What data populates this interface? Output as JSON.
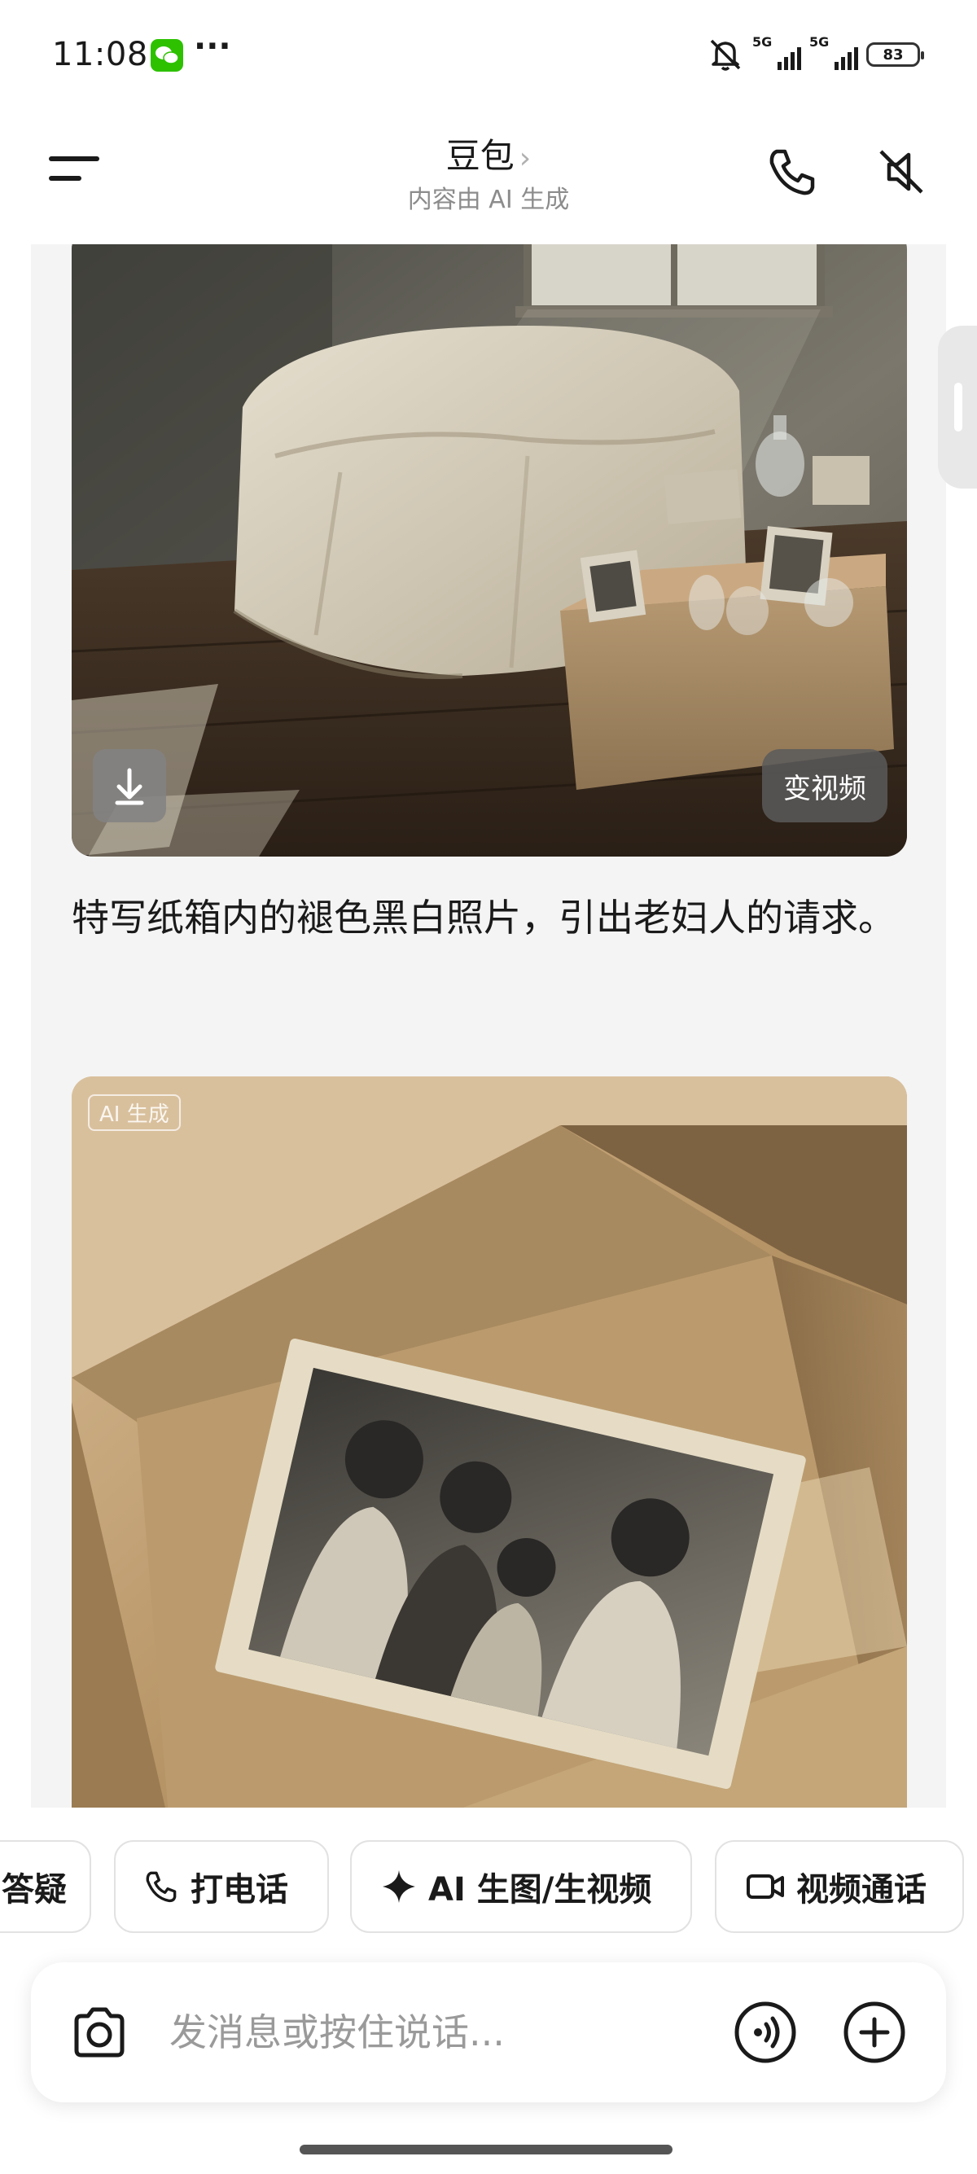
{
  "status_bar": {
    "time": "11:08",
    "more": "···",
    "signal1_label": "5G",
    "signal2_label": "5G",
    "battery": "83",
    "icons": [
      "wechat-icon",
      "bell-off-icon",
      "signal-icon",
      "battery-icon"
    ]
  },
  "header": {
    "title": "豆包",
    "subtitle": "内容由 AI 生成",
    "icons": [
      "menu-icon",
      "chevron-right-icon",
      "phone-icon",
      "speaker-mute-icon"
    ]
  },
  "chat": {
    "image1": {
      "download_icon": "download-icon",
      "video_button": "变视频"
    },
    "caption": "特写纸箱内的褪色黑白照片，引出老妇人的请求。",
    "image2": {
      "badge": "AI 生成"
    }
  },
  "chips": [
    {
      "label": "答疑",
      "icon": ""
    },
    {
      "label": "打电话",
      "icon": "phone-icon"
    },
    {
      "label": "AI 生图/生视频",
      "icon": "sparkle-icon"
    },
    {
      "label": "视频通话",
      "icon": "video-camera-icon"
    }
  ],
  "input_bar": {
    "placeholder": "发消息或按住说话...",
    "icons": [
      "camera-icon",
      "voice-icon",
      "plus-icon"
    ]
  },
  "colors": {
    "chat_background": "#f4f4f4",
    "text": "#1a1a1a",
    "muted": "#8c8c8c",
    "wechat_green": "#2dc100"
  }
}
